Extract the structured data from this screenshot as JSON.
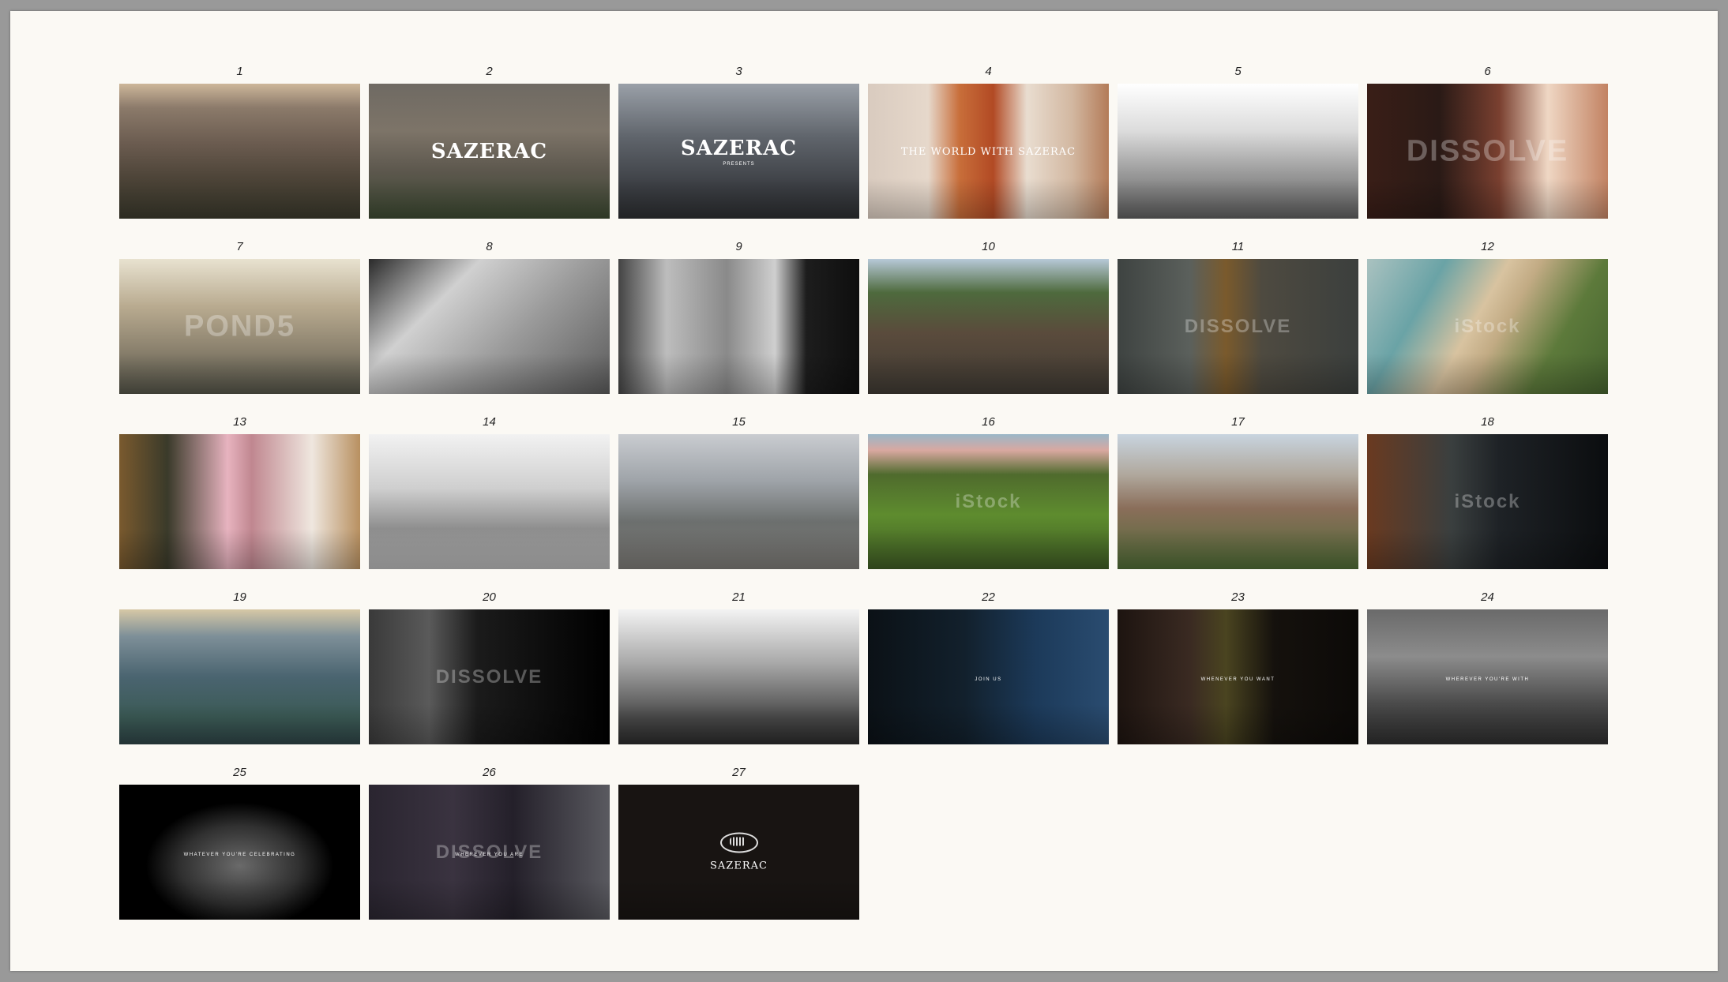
{
  "frames": [
    {
      "num": "1",
      "scene": "aerial-city-dusk",
      "bg": "linear-gradient(180deg,#cdb79a 0%,#8b7a6a 18%,#6a5b4f 45%,#4d4438 70%,#3b3a2c 100%)"
    },
    {
      "num": "2",
      "scene": "aerial-cathedral-title",
      "bg": "linear-gradient(180deg,#6f6a63 0%,#7d7468 35%,#5c574d 65%,#3d4a32 100%)",
      "overlay": "SAZERAC",
      "overlay_style": "big"
    },
    {
      "num": "3",
      "scene": "rooftops-street-title",
      "bg": "linear-gradient(180deg,#9aa0a8 0%,#5f646b 40%,#3d4045 75%,#2c2e31 100%)",
      "overlay": "SAZERAC",
      "overlay_sub": "PRESENTS",
      "overlay_style": "big"
    },
    {
      "num": "4",
      "scene": "cocktail-glass",
      "bg": "linear-gradient(90deg,#d9cbbf 0%,#e6d8cb 25%,#c86e3a 38%,#b24a24 52%,#e9ddd0 66%,#d2b7a0 85%,#b37b58 100%)",
      "overlay": "THE WORLD WITH SAZERAC",
      "overlay_style": "med"
    },
    {
      "num": "5",
      "scene": "toast-bw",
      "bg": "linear-gradient(180deg,#ffffff 0%,#dcdcdc 35%,#9d9d9d 65%,#5e5e5e 100%)"
    },
    {
      "num": "6",
      "scene": "closeup-warm",
      "bg": "linear-gradient(90deg,#3a1e17 0%,#2a1a16 30%,#7a4030 55%,#efd7c4 75%,#c28262 100%)",
      "watermark": "DISSOLVE"
    },
    {
      "num": "7",
      "scene": "building-sunflare",
      "bg": "linear-gradient(180deg,#e8e2d0 0%,#b9ab90 35%,#8e8470 65%,#545448 100%)",
      "watermark": "POND5"
    },
    {
      "num": "8",
      "scene": "stairs-heels-bw",
      "bg": "linear-gradient(135deg,#2a2a2a 0%,#d0d0d0 30%,#9a9a9a 60%,#5a5a5a 100%)"
    },
    {
      "num": "9",
      "scene": "men-suits-balcony-bw",
      "bg": "linear-gradient(90deg,#444 0%,#bdbdbd 20%,#8a8a8a 45%,#cfcfcf 65%,#1d1d1d 78%,#0e0e0e 100%)"
    },
    {
      "num": "10",
      "scene": "town-water-tower",
      "bg": "linear-gradient(180deg,#b7c9d8 0%,#4e6a3d 25%,#5a4b3c 55%,#3f3a33 100%)"
    },
    {
      "num": "11",
      "scene": "whisky-splash",
      "bg": "linear-gradient(90deg,#3e4341 0%,#5b605c 30%,#7a5a2c 45%,#4e4a40 60%,#3b3f3d 100%)",
      "watermark": "DISSOLVE",
      "wm_small": true
    },
    {
      "num": "12",
      "scene": "beach-aerial",
      "bg": "linear-gradient(120deg,#aac2c0 0%,#6aa3a6 25%,#d8c3a0 45%,#c2ab84 55%,#5d7a3b 75%,#45622e 100%)",
      "watermark": "iStock",
      "wm_small": true
    },
    {
      "num": "13",
      "scene": "pink-cocktail-bartender",
      "bg": "linear-gradient(90deg,#7a5a2e 0%,#3a3a2a 20%,#e7b3bf 45%,#c08790 55%,#efe7df 80%,#b89060 100%)"
    },
    {
      "num": "14",
      "scene": "yacht-interior-bw",
      "bg": "linear-gradient(180deg,#f2f2f2 0%,#cfcfcf 40%,#8e8e8e 70%,#b9b9b9 100%)"
    },
    {
      "num": "15",
      "scene": "city-spire-aerial",
      "bg": "linear-gradient(180deg,#c9ccd0 0%,#9ea3a8 35%,#6c6f6e 65%,#7c7a76 100%)"
    },
    {
      "num": "16",
      "scene": "green-valley",
      "bg": "linear-gradient(180deg,#9ab7c8 0%,#d9a8a0 12%,#4f6b2d 30%,#5e8c2e 60%,#3e5a24 100%)",
      "watermark": "iStock",
      "wm_small": true
    },
    {
      "num": "17",
      "scene": "red-church-aerial",
      "bg": "linear-gradient(180deg,#c8d4df 0%,#b0a89d 30%,#8a6e5a 55%,#4e6b35 100%)"
    },
    {
      "num": "18",
      "scene": "city-night-aerial",
      "bg": "linear-gradient(90deg,#6a3a20 0%,#3a3f3f 35%,#1e2226 55%,#0b0d0f 100%)",
      "watermark": "iStock",
      "wm_small": true
    },
    {
      "num": "19",
      "scene": "london-skyline",
      "bg": "linear-gradient(180deg,#d6c8a6 0%,#7d8f98 20%,#4a6470 50%,#3b5a55 80%,#2e4446 100%)"
    },
    {
      "num": "20",
      "scene": "night-city-silhouette-bw",
      "bg": "linear-gradient(90deg,#3a3a3a 0%,#5a5a5a 25%,#1b1b1b 45%,#000000 100%)",
      "watermark": "DISSOLVE",
      "wm_small": true
    },
    {
      "num": "21",
      "scene": "martini-glasses-bw",
      "bg": "linear-gradient(180deg,#f3f3f3 0%,#a8a8a8 40%,#4a4a4a 80%,#2a2a2a 100%)"
    },
    {
      "num": "22",
      "scene": "man-dark-window",
      "bg": "linear-gradient(90deg,#0b1116 0%,#12202c 40%,#1c3a5a 70%,#2a4c70 100%)",
      "overlay": "JOIN US",
      "overlay_style": "sm"
    },
    {
      "num": "23",
      "scene": "neon-sign-couple",
      "bg": "linear-gradient(90deg,#1d1410 0%,#3a2a22 30%,#4a4420 45%,#15110d 65%,#0c0a08 100%)",
      "overlay": "WHENEVER YOU WANT",
      "overlay_style": "sm"
    },
    {
      "num": "24",
      "scene": "cheers-glasses-bw",
      "bg": "linear-gradient(180deg,#6a6a6a 0%,#8c8c8c 35%,#4a4a4a 70%,#2e2e2e 100%)",
      "overlay": "WHEREVER YOU'RE WITH",
      "overlay_style": "sm"
    },
    {
      "num": "25",
      "scene": "bar-crowd-bw",
      "bg": "radial-gradient(ellipse at 50% 60%,#6a6a6a 0%,#303030 35%,#000000 55%)",
      "overlay": "WHATEVER YOU'RE CELEBRATING",
      "overlay_style": "sm"
    },
    {
      "num": "26",
      "scene": "martini-olive",
      "bg": "linear-gradient(90deg,#2a2530 0%,#3a3340 35%,#24202a 60%,#5a5a60 100%)",
      "overlay": "WHEREVER YOU ARE",
      "overlay_style": "sm",
      "watermark": "DISSOLVE",
      "wm_small": true
    },
    {
      "num": "27",
      "scene": "sazerac-end-card",
      "bg": "#181412",
      "overlay": "SAZERAC",
      "overlay_style": "logo"
    }
  ]
}
